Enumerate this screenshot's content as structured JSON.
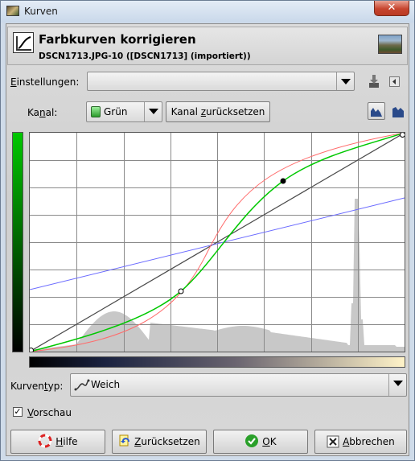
{
  "window": {
    "title": "Kurven",
    "close_glyph": "✕"
  },
  "header": {
    "title": "Farbkurven korrigieren",
    "subtitle": "DSCN1713.JPG-10 ([DSCN1713] (importiert))",
    "icon": "curves-tool-icon",
    "thumbnail": "image-thumbnail"
  },
  "settings": {
    "label_first": "E",
    "label_rest": "instellungen:",
    "value": ""
  },
  "channel": {
    "label_pre": "Ka",
    "label_u": "n",
    "label_post": "al:",
    "value": "Grün",
    "reset_pre": "Kanal ",
    "reset_u": "z",
    "reset_post": "urücksetzen"
  },
  "curve": {
    "channel_color": "#00c800",
    "linear_color": "#4a4a4a",
    "red_color": "#ff6b6b",
    "blue_color": "#6b6bff"
  },
  "curve_type": {
    "label_pre": "Kurven",
    "label_u": "t",
    "label_post": "yp:",
    "value": "Weich"
  },
  "preview": {
    "checked": true,
    "label_u": "V",
    "label_rest": "orschau"
  },
  "buttons": {
    "help_u": "H",
    "help_rest": "ilfe",
    "reset_u": "Z",
    "reset_rest": "urücksetzen",
    "ok_u": "O",
    "ok_rest": "K",
    "cancel_u": "A",
    "cancel_rest": "bbrechen"
  }
}
